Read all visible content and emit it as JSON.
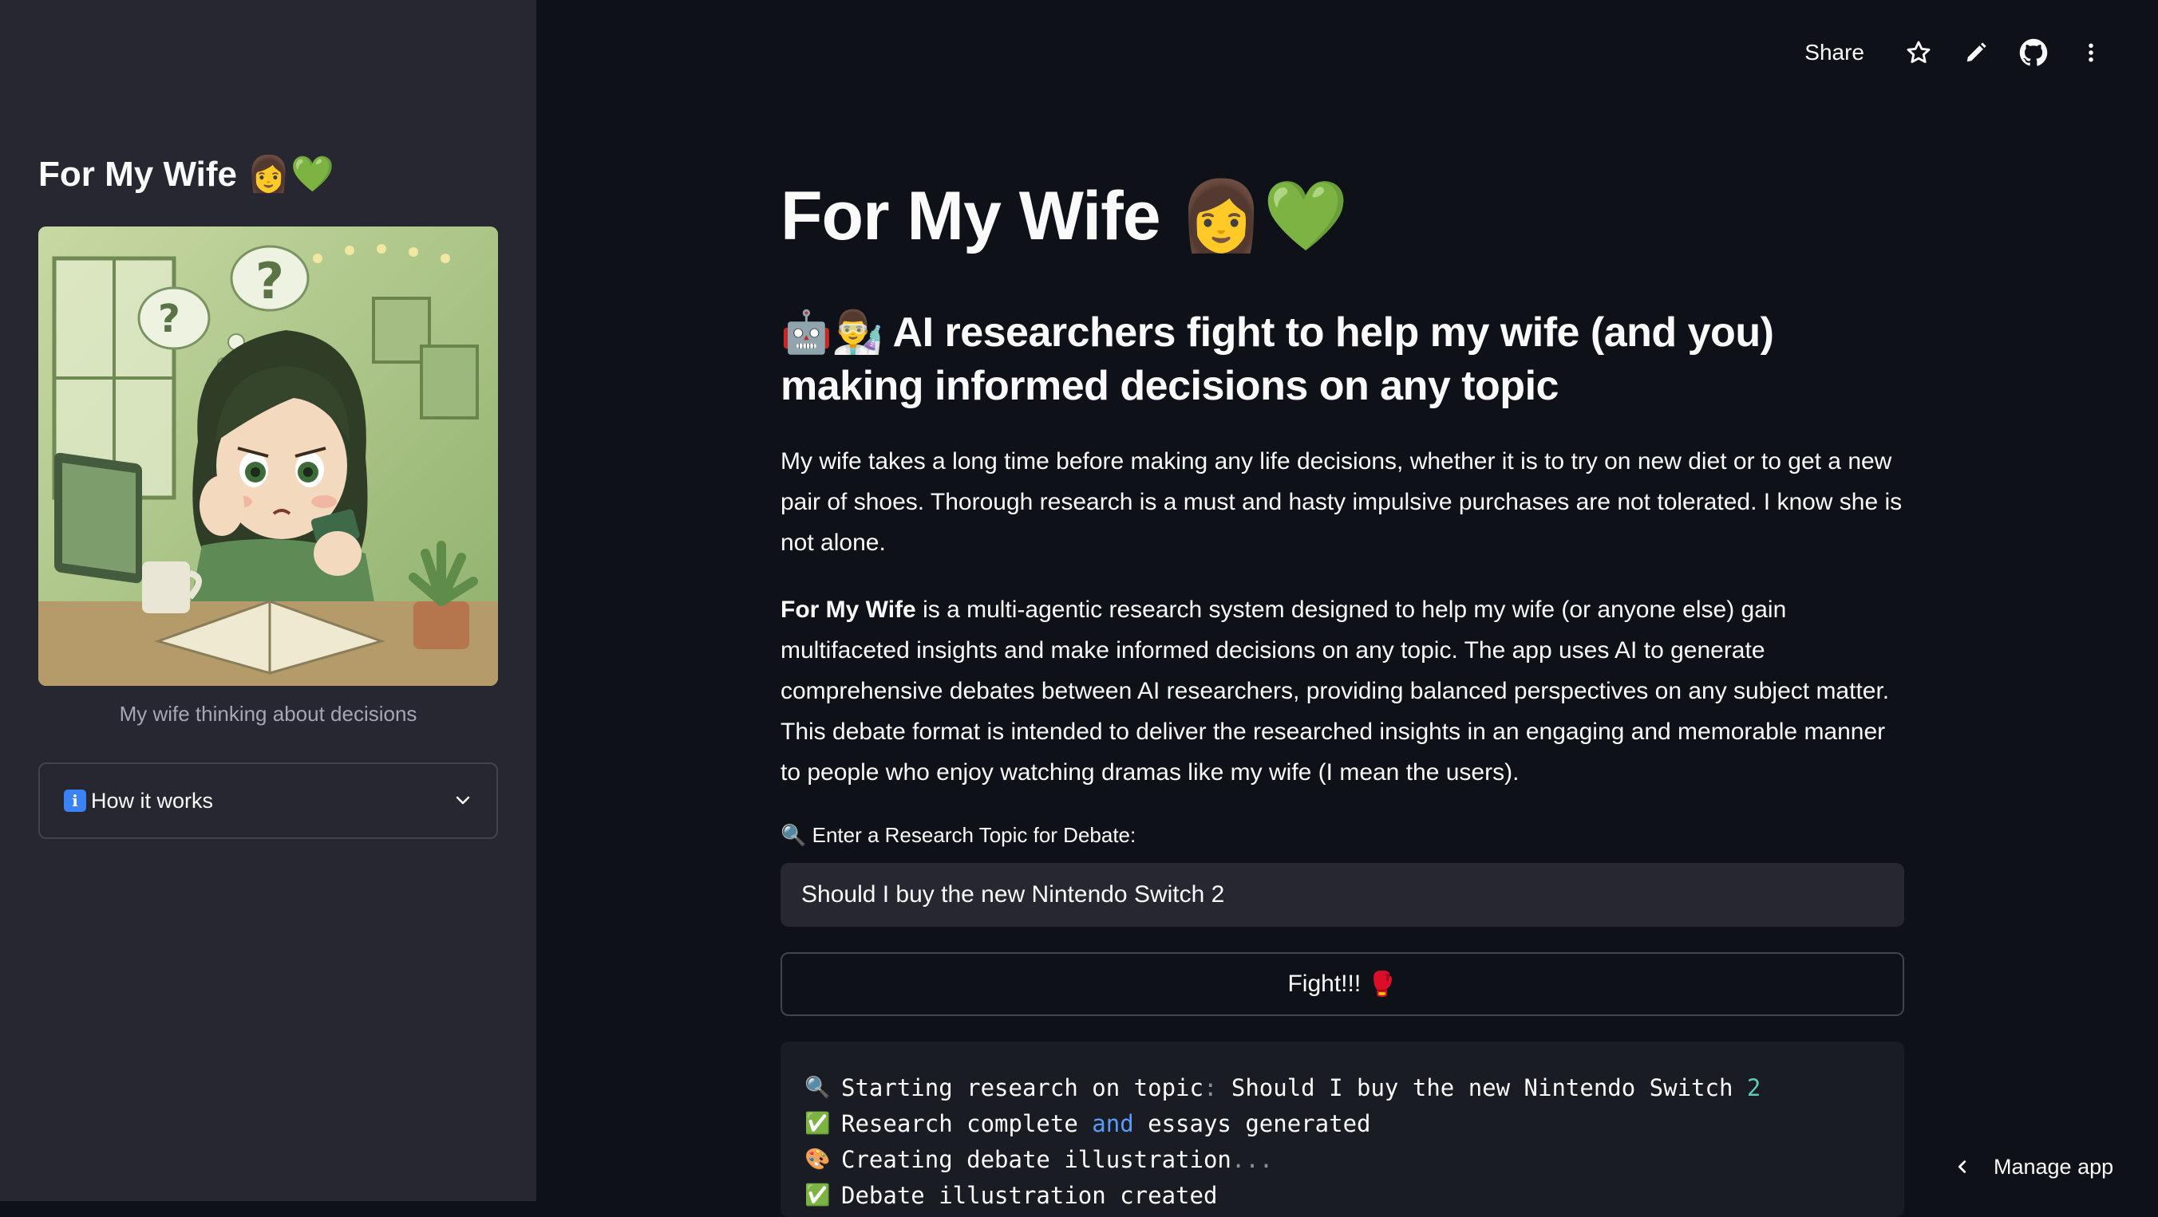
{
  "sidebar": {
    "title": "For My Wife 👩💚",
    "image_caption": "My wife thinking about decisions",
    "expander_label": "How it works"
  },
  "toolbar": {
    "share_label": "Share",
    "icons": [
      "star-icon",
      "pencil-icon",
      "github-icon",
      "more-vertical-icon"
    ]
  },
  "main": {
    "title": "For My Wife 👩💚",
    "subtitle": "🤖👨‍🔬 AI researchers fight to help my wife (and you) making informed decisions on any topic",
    "paragraph1": "My wife takes a long time before making any life decisions, whether it is to try on new diet or to get a new pair of shoes. Thorough research is a must and hasty impulsive purchases are not tolerated. I know she is not alone.",
    "paragraph2_bold": "For My Wife",
    "paragraph2_rest": " is a multi-agentic research system designed to help my wife (or anyone else) gain multifaceted insights and make informed decisions on any topic. The app uses AI to generate comprehensive debates between AI researchers, providing balanced perspectives on any subject matter. This debate format is intended to deliver the researched insights in an engaging and memorable manner to people who enjoy watching dramas like my wife (I mean the users).",
    "input_label": "Enter a Research Topic for Debate:",
    "input_value": "Should I buy the new Nintendo Switch 2",
    "button_label": "Fight!!!",
    "log": {
      "line1_icon": "🔍",
      "line1_text": "Starting research on topic",
      "line1_colon": ":",
      "line1_topic": " Should I buy the new Nintendo Switch ",
      "line1_num": "2",
      "line2_icon": "✅",
      "line2_a": "Research complete ",
      "line2_kw": "and",
      "line2_b": " essays generated",
      "line3_icon": "🎨",
      "line3_text": "Creating debate illustration",
      "line3_dots": "...",
      "line4_icon": "✅",
      "line4_text": "Debate illustration created"
    }
  },
  "manage_app_label": "Manage app",
  "colors": {
    "background": "#0e1117",
    "sidebar": "#262730",
    "input_bg": "#262730",
    "keyword": "#5a9bff",
    "number": "#5ec9b8"
  }
}
